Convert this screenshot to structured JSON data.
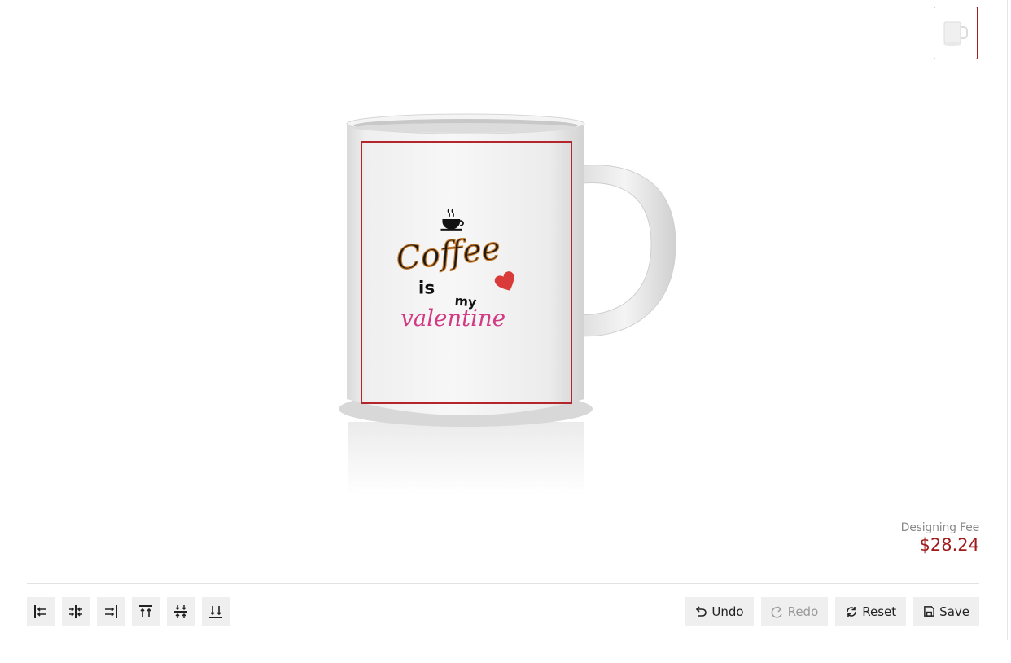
{
  "product": {
    "thumbnail_icon": "mug-thumbnail-icon",
    "design_text": {
      "line1": "Coffee",
      "line2a": "is",
      "line2b": "my",
      "line3": "valentine"
    },
    "print_area_color": "#b5262c"
  },
  "pricing": {
    "label": "Designing Fee",
    "amount": "$28.24",
    "amount_color": "#a01c1c"
  },
  "align_tools": [
    {
      "name": "align-left-icon"
    },
    {
      "name": "align-center-horizontal-icon"
    },
    {
      "name": "align-right-icon"
    },
    {
      "name": "align-top-icon"
    },
    {
      "name": "align-middle-vertical-icon"
    },
    {
      "name": "align-bottom-icon"
    }
  ],
  "actions": {
    "undo": "Undo",
    "redo": "Redo",
    "reset": "Reset",
    "save": "Save"
  }
}
